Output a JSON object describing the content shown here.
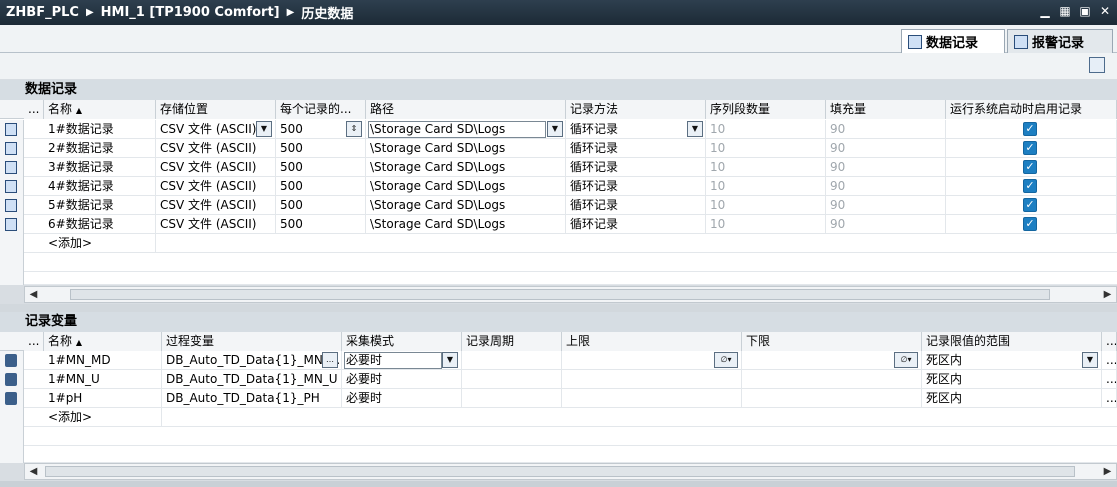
{
  "titlebar": {
    "project": "ZHBF_PLC",
    "device": "HMI_1 [TP1900 Comfort]",
    "page": "历史数据"
  },
  "view_tabs": [
    {
      "label": "数据记录",
      "active": true
    },
    {
      "label": "报警记录",
      "active": false
    }
  ],
  "data_logs": {
    "title": "数据记录",
    "headers": [
      "...",
      "名称",
      "存储位置",
      "每个记录的...",
      "路径",
      "记录方法",
      "序列段数量",
      "填充量",
      "运行系统启动时启用记录"
    ],
    "rows": [
      {
        "name": "1#数据记录",
        "storage": "CSV 文件 (ASCII)",
        "records": "500",
        "path": "\\Storage Card SD\\Logs",
        "method": "循环记录",
        "segments": "10",
        "fill": "90",
        "enabled": true
      },
      {
        "name": "2#数据记录",
        "storage": "CSV 文件 (ASCII)",
        "records": "500",
        "path": "\\Storage Card SD\\Logs",
        "method": "循环记录",
        "segments": "10",
        "fill": "90",
        "enabled": true
      },
      {
        "name": "3#数据记录",
        "storage": "CSV 文件 (ASCII)",
        "records": "500",
        "path": "\\Storage Card SD\\Logs",
        "method": "循环记录",
        "segments": "10",
        "fill": "90",
        "enabled": true
      },
      {
        "name": "4#数据记录",
        "storage": "CSV 文件 (ASCII)",
        "records": "500",
        "path": "\\Storage Card SD\\Logs",
        "method": "循环记录",
        "segments": "10",
        "fill": "90",
        "enabled": true
      },
      {
        "name": "5#数据记录",
        "storage": "CSV 文件 (ASCII)",
        "records": "500",
        "path": "\\Storage Card SD\\Logs",
        "method": "循环记录",
        "segments": "10",
        "fill": "90",
        "enabled": true
      },
      {
        "name": "6#数据记录",
        "storage": "CSV 文件 (ASCII)",
        "records": "500",
        "path": "\\Storage Card SD\\Logs",
        "method": "循环记录",
        "segments": "10",
        "fill": "90",
        "enabled": true
      }
    ],
    "add_label": "<添加>"
  },
  "log_tags": {
    "title": "记录变量",
    "headers": [
      "...",
      "名称",
      "过程变量",
      "采集模式",
      "记录周期",
      "上限",
      "下限",
      "记录限值的范围",
      "..."
    ],
    "rows": [
      {
        "name": "1#MN_MD",
        "process_tag": "DB_Auto_TD_Data{1}_MN_...",
        "mode": "必要时",
        "range": "死区内"
      },
      {
        "name": "1#MN_U",
        "process_tag": "DB_Auto_TD_Data{1}_MN_U",
        "mode": "必要时",
        "range": "死区内"
      },
      {
        "name": "1#pH",
        "process_tag": "DB_Auto_TD_Data{1}_PH",
        "mode": "必要时",
        "range": "死区内"
      }
    ],
    "add_label": "<添加>"
  },
  "colors": {
    "titlebar": "#1c2a36",
    "checkbox": "#1d7fc2"
  }
}
